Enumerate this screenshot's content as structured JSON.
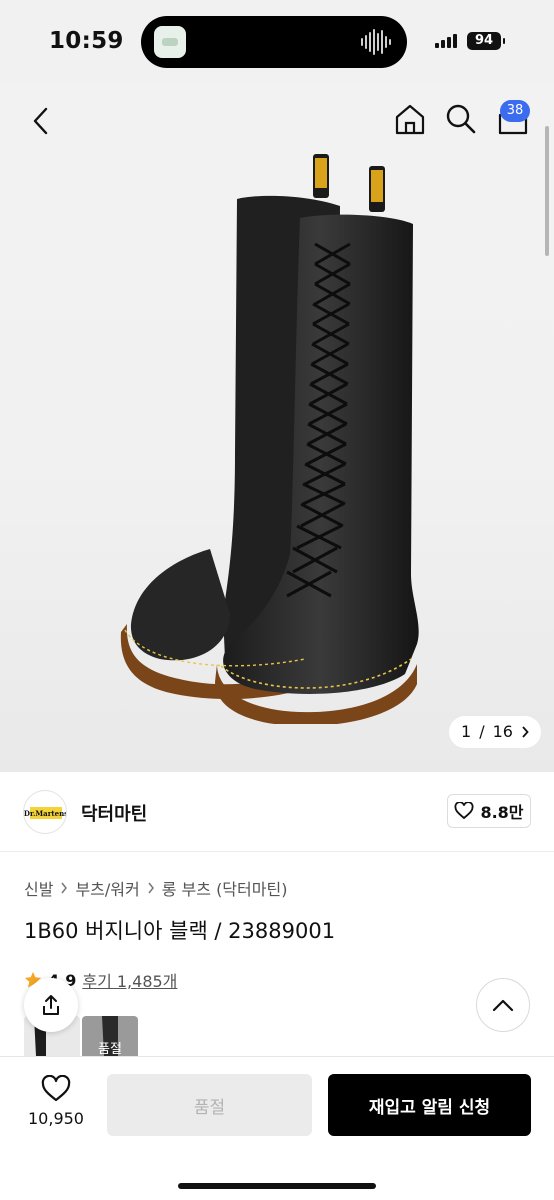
{
  "status_bar": {
    "time": "10:59",
    "battery": "94"
  },
  "header": {
    "cart_count": "38"
  },
  "gallery": {
    "current": "1",
    "separator": "/",
    "total": "16"
  },
  "brand": {
    "name": "닥터마틴",
    "likes": "8.8만",
    "logo_text": "Dr.Martens"
  },
  "breadcrumb": [
    "신발",
    "부츠/워커",
    "롱 부츠 (닥터마틴)"
  ],
  "product": {
    "title": "1B60 버지니아 블랙 / 23889001",
    "rating": "4.9",
    "review_label": "후기 1,485개"
  },
  "thumbnails": [
    {
      "label": ""
    },
    {
      "label": "품절"
    }
  ],
  "bottom_bar": {
    "wish_count": "10,950",
    "soldout_label": "품절",
    "restock_label": "재입고 알림 신청"
  },
  "colors": {
    "accent": "#3b6cf0",
    "star": "#f5a623",
    "primary_button": "#000000",
    "disabled_button": "#ebebeb"
  },
  "icons": [
    "back-icon",
    "home-icon",
    "search-icon",
    "cart-icon",
    "heart-icon",
    "share-icon",
    "chevron-up-icon",
    "chevron-right-icon",
    "star-icon"
  ]
}
